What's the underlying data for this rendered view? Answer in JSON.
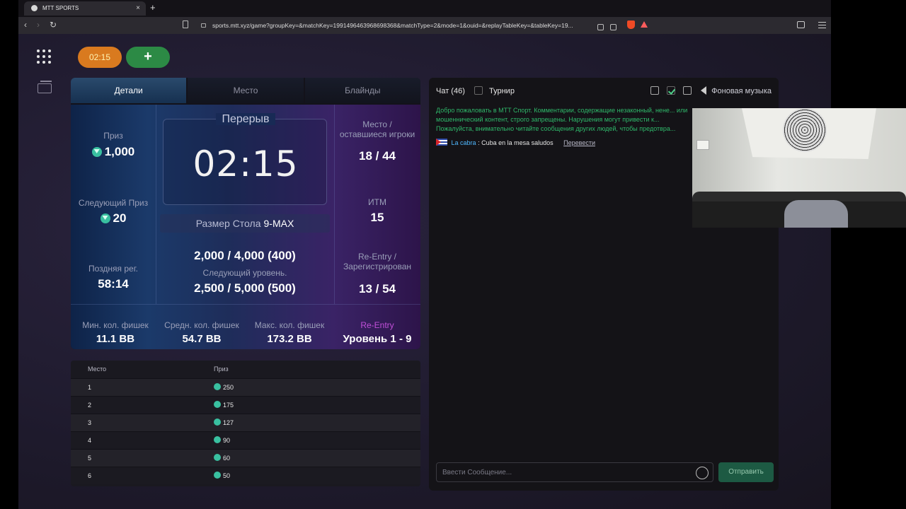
{
  "browser": {
    "tab_title": "MTT SPORTS",
    "url": "sports.mtt.xyz/game?groupKey=&matchKey=1991496463968698368&matchType=2&mode=1&ouid=&replayTableKey=&tableKey=19..."
  },
  "topbar": {
    "timer": "02:15",
    "add_label": "+"
  },
  "panel": {
    "tabs": [
      "Детали",
      "Место",
      "Блайнды"
    ],
    "prize_label": "Приз",
    "prize_value": "1,000",
    "next_prize_label": "Следующий Приз",
    "next_prize_value": "20",
    "late_reg_label": "Поздняя рег.",
    "late_reg_value": "58:14",
    "break_title": "Перерыв",
    "clock": "02:15",
    "table_size_label": "Размер Стола",
    "table_size_value": "9-MAX",
    "current_level": "2,000 / 4,000 (400)",
    "next_level_label": "Следующий уровень.",
    "next_level": "2,500 / 5,000 (500)",
    "place_label": "Место /\nоставшиеся игроки",
    "place_value": "18 / 44",
    "itm_label": "ИТМ",
    "itm_value": "15",
    "reentry_label": "Re-Entry /\nЗарегистрирован",
    "reentry_value": "13 / 54",
    "min_stack_label": "Мин. кол. фишек",
    "min_stack_value": "11.1 BB",
    "avg_stack_label": "Средн. кол. фишек",
    "avg_stack_value": "54.7 BB",
    "max_stack_label": "Макс. кол. фишек",
    "max_stack_value": "173.2 BB",
    "reentry_levels_label": "Re-Entry",
    "reentry_levels_value": "Уровень 1 - 9"
  },
  "payouts": {
    "headers": [
      "Место",
      "Приз"
    ],
    "rows": [
      {
        "place": "1",
        "prize": "250"
      },
      {
        "place": "2",
        "prize": "175"
      },
      {
        "place": "3",
        "prize": "127"
      },
      {
        "place": "4",
        "prize": "90"
      },
      {
        "place": "5",
        "prize": "60"
      },
      {
        "place": "6",
        "prize": "50"
      }
    ]
  },
  "chat": {
    "title": "Чат (46)",
    "tournament_label": "Турнир",
    "music_label": "Фоновая музыка",
    "welcome": "Добро пожаловать в MTT Спорт. Комментарии, содержащие незаконный, нене... или мошеннический контент, строго запрещены. Нарушения могут привести к... Пожалуйста, внимательно читайте сообщения других людей, чтобы предотвра...",
    "message_user": "La cabra",
    "message_text": ": Cuba en la mesa saludos",
    "translate_label": "Перевести",
    "input_placeholder": "Ввести Сообщение...",
    "send_label": "Отправить"
  },
  "colors": {
    "timer_orange": "#d97a1f",
    "add_green": "#2c8a45",
    "welcome_green": "#2fb86a",
    "reentry_purple": "#c04fd8"
  }
}
